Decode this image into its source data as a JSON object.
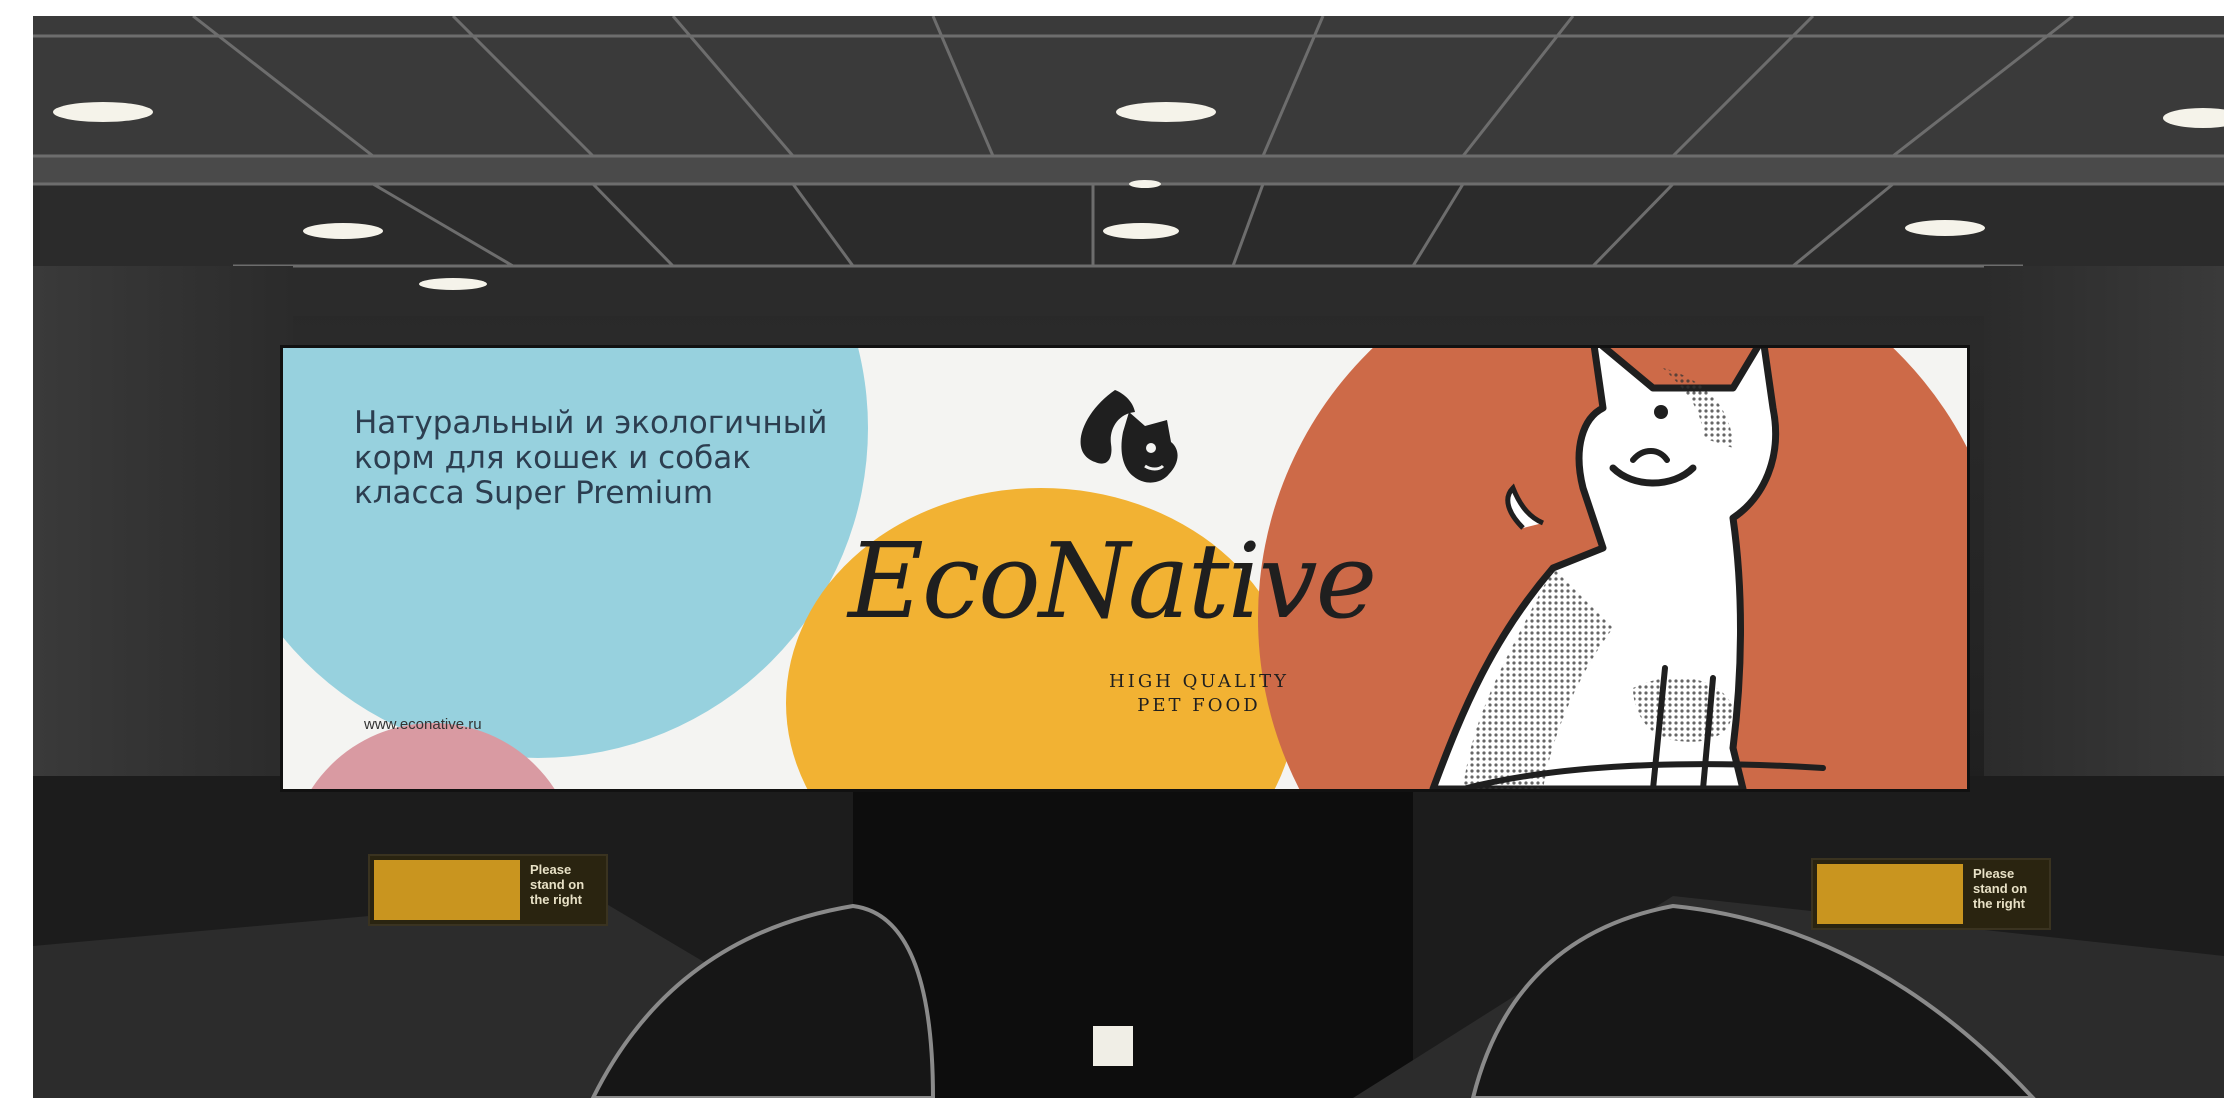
{
  "ad": {
    "headline_lines": [
      "Натуральный и экологичный",
      "корм для кошек и собак",
      "класса Super Premium"
    ],
    "brand": "EcoNative",
    "tagline_lines": [
      "HIGH QUALITY",
      "PET FOOD"
    ],
    "website": "www.econative.ru"
  },
  "signs": {
    "left": [
      "Please",
      "stand on",
      "the right"
    ],
    "right": [
      "Please",
      "stand on",
      "the right"
    ]
  },
  "colors": {
    "blue": "#97d1de",
    "yellow": "#f2b233",
    "orange": "#cd6a48",
    "pink": "#d99aa2",
    "ink": "#1f1f1f"
  }
}
